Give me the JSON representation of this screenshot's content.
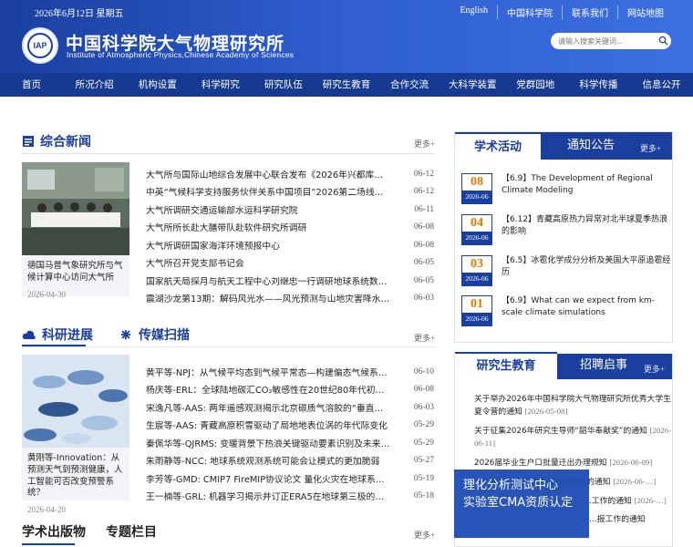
{
  "header": {
    "date": "2026年6月12日   星期五",
    "top_links": [
      "English",
      "中国科学院",
      "联系我们",
      "网站地图"
    ],
    "logo_text": "IAP",
    "title_cn": "中国科学院大气物理研究所",
    "title_en": "Institute of Atmospheric Physics,Chinese Academy of Sciences",
    "search_placeholder": "请输入搜索关键词..."
  },
  "nav": [
    "首页",
    "所况介绍",
    "机构设置",
    "科学研究",
    "研究队伍",
    "研究生教育",
    "合作交流",
    "大科学装置",
    "党群园地",
    "科学传播",
    "信息公开"
  ],
  "news": {
    "title": "综合新闻",
    "more": "更多+",
    "photo_caption": "德国马普气象研究所与气候计算中心访问大气所",
    "photo_date": "2026-04-30",
    "items": [
      {
        "title": "大气所与国际山地综合发展中心联合发布《2026年兴都库什-喜马…",
        "date": "06-12"
      },
      {
        "title": "中英“气候科学支持服务伙伴关系中国项目”2026第二场线上研讨…",
        "date": "06-12"
      },
      {
        "title": "大气所调研交通运输部水运科学研究院",
        "date": "06-11"
      },
      {
        "title": "大气所所长赴大膳带队赴软件研究所调研",
        "date": "06-08"
      },
      {
        "title": "大气所调研国家海洋环境预报中心",
        "date": "06-08"
      },
      {
        "title": "大气所召开党支部书记会",
        "date": "06-05"
      },
      {
        "title": "国家航天局探月与航天工程中心刘继忠一行调研地球系统数值模…",
        "date": "06-05"
      },
      {
        "title": "震湖沙龙第13期：解码风光水——风光预测与山地灾害降水模拟",
        "date": "06-03"
      }
    ]
  },
  "research": {
    "title1": "科研进展",
    "title2": "传媒扫描",
    "more": "更多+",
    "photo_caption": "黄刚等-Innovation：从预测天气到预测健康，人工智能可否改变预警系统？",
    "photo_date": "2026-04-20",
    "items": [
      {
        "title": "黄平等-NPJ：从气候平均态到气候平常态—构建偏态气候系统研…",
        "date": "06-10"
      },
      {
        "title": "杨庆等-ERL：全球陆地碳汇CO₂敏感性在20世纪80年代初期快…",
        "date": "06-08"
      },
      {
        "title": "宋逸凡等-AAS: 两年遥感观测揭示北京碳质气溶胶的“垂直密码”",
        "date": "06-03"
      },
      {
        "title": "生宸等-AAS: 青藏高原积雪驱动了局地地表位涡的年代际变化",
        "date": "05-29"
      },
      {
        "title": "秦佩华等-QJRMS: 变暖背景下热浪关键驱动要素识别及未来变化",
        "date": "05-29"
      },
      {
        "title": "朱雨静等-NCC: 地球系统观测系统可能会让模式的更加脆弱",
        "date": "05-27"
      },
      {
        "title": "李芳等-GMD: CMIP7 FireMIP协议论文 量化火灾在地球系统中的…",
        "date": "05-19"
      },
      {
        "title": "王一楠等-GRL: 机器学习揭示并订正ERA5在地球第三极的云底高…",
        "date": "05-18"
      }
    ]
  },
  "publish": {
    "title1": "学术出版物",
    "title2": "专题栏目",
    "more": "更多+"
  },
  "activities": {
    "tab_active": "学术活动",
    "tab_inactive": "通知公告",
    "more": "更多+",
    "items": [
      {
        "day": "08",
        "ym": "2026-06",
        "text": "【6.9】The Development of Regional Climate Modeling"
      },
      {
        "day": "04",
        "ym": "2026-06",
        "text": "【6.12】青藏高原热力异常对北半球夏季热浪的影响"
      },
      {
        "day": "03",
        "ym": "2026-06",
        "text": "【6.5】冰雹化学成分分析及美国大平原追雹经历"
      },
      {
        "day": "01",
        "ym": "2026-06",
        "text": "【6.9】What can we expect from km-scale climate simulations"
      }
    ]
  },
  "grad": {
    "tab_active": "研究生教育",
    "tab_inactive": "招聘启事",
    "more": "更多+",
    "items": [
      {
        "title": "关于举办2026年中国科学院大气物理研究所优秀大学生夏令营的通知",
        "date": "[2026-05-08]"
      },
      {
        "title": "关于征集2026年研究生导师“韶华奉献奖”的通知",
        "date": "[2026-06-11]"
      },
      {
        "title": "2026届毕业生户口批量迁出办理规知",
        "date": "[2026-06-09]"
      },
      {
        "title": "关于对研究生宿舍进行安全检查的通知",
        "date": "[2026-06-…]"
      },
      {
        "title": "…工作的通知",
        "date": "[2026-…]"
      },
      {
        "title": "…报工作的通知",
        "date": ""
      }
    ]
  },
  "banner": {
    "line1": "理化分析测试中心",
    "line2": "实验室CMA资质认定"
  }
}
